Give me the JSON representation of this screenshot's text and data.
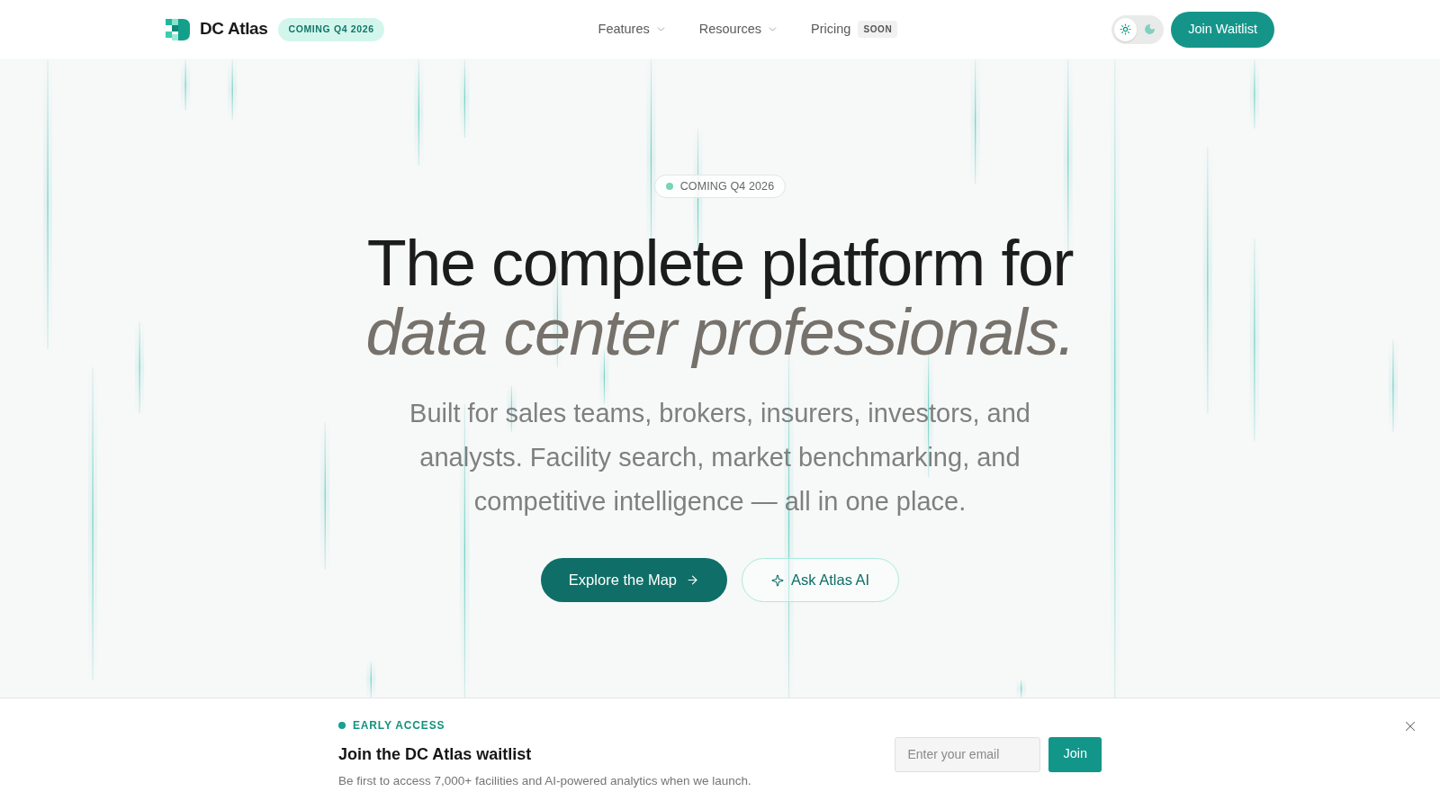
{
  "header": {
    "logo_text": "DC Atlas",
    "badge": "COMING Q4 2026",
    "nav": [
      {
        "label": "Features",
        "kind": "dropdown"
      },
      {
        "label": "Resources",
        "kind": "dropdown"
      },
      {
        "label": "Pricing",
        "kind": "link",
        "badge": "SOON"
      }
    ],
    "theme_toggle": [
      {
        "kind": "sun",
        "selected": true
      },
      {
        "kind": "moon",
        "selected": false
      }
    ],
    "cta": "Join Waitlist"
  },
  "hero": {
    "badge": "COMING Q4 2026",
    "title": "The complete platform for",
    "title_emphasis": "data center professionals.",
    "subtitle": "Built for sales teams, brokers, insurers, investors, and analysts. Facility search, market benchmarking, and competitive intelligence — all in one place.",
    "buttons": [
      {
        "label": "Explore the Map",
        "kind": "primary"
      },
      {
        "label": "Ask Atlas AI",
        "kind": "secondary"
      }
    ]
  },
  "waitlist_banner": {
    "eyebrow": "EARLY ACCESS",
    "title": "Join the DC Atlas waitlist",
    "description": "Be first to access 7,000+ facilities and AI-powered analytics when we launch.",
    "email": {
      "placeholder": "Enter your email"
    },
    "submit": "Join"
  }
}
